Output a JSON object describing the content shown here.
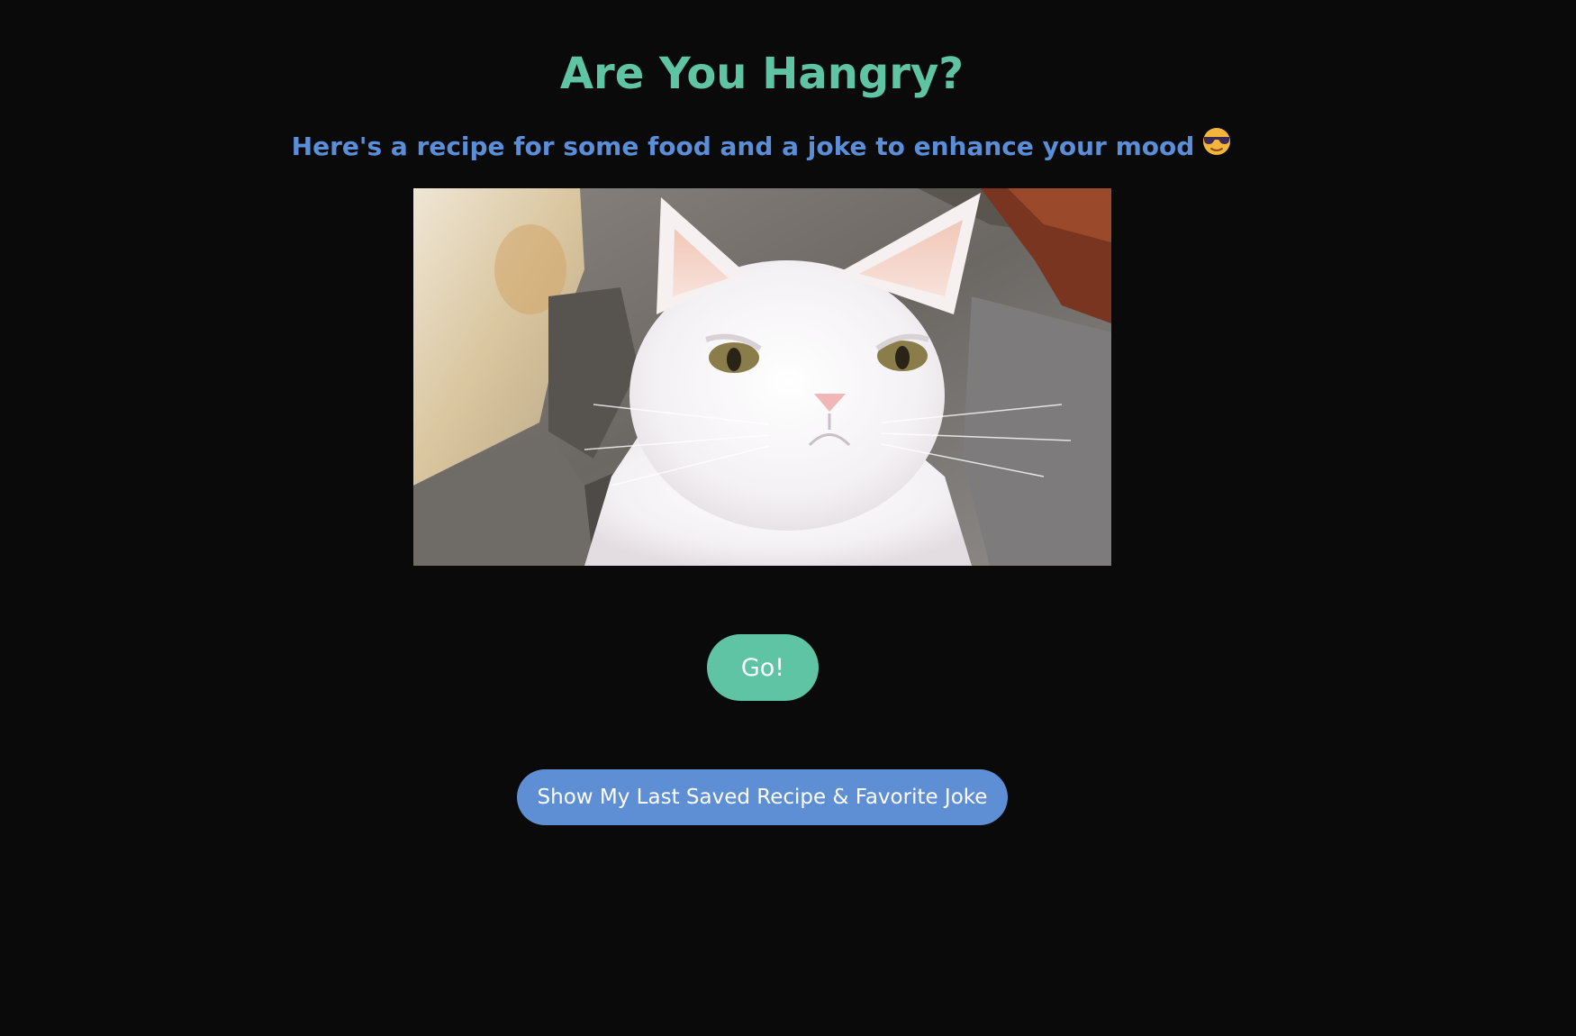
{
  "header": {
    "title": "Are You Hangry?",
    "subtitle": "Here's a recipe for some food and a joke to enhance your mood",
    "subtitle_icon": "sunglasses-face-icon"
  },
  "image": {
    "description_icon": "grumpy-cat-photo"
  },
  "actions": {
    "go_label": "Go!",
    "saved_label": "Show My Last Saved Recipe & Favorite Joke"
  },
  "colors": {
    "background": "#0a0a0b",
    "title": "#5fc4a3",
    "subtitle": "#5b8ed8",
    "go_button": "#5fc4a3",
    "saved_button": "#5e8fd5"
  }
}
